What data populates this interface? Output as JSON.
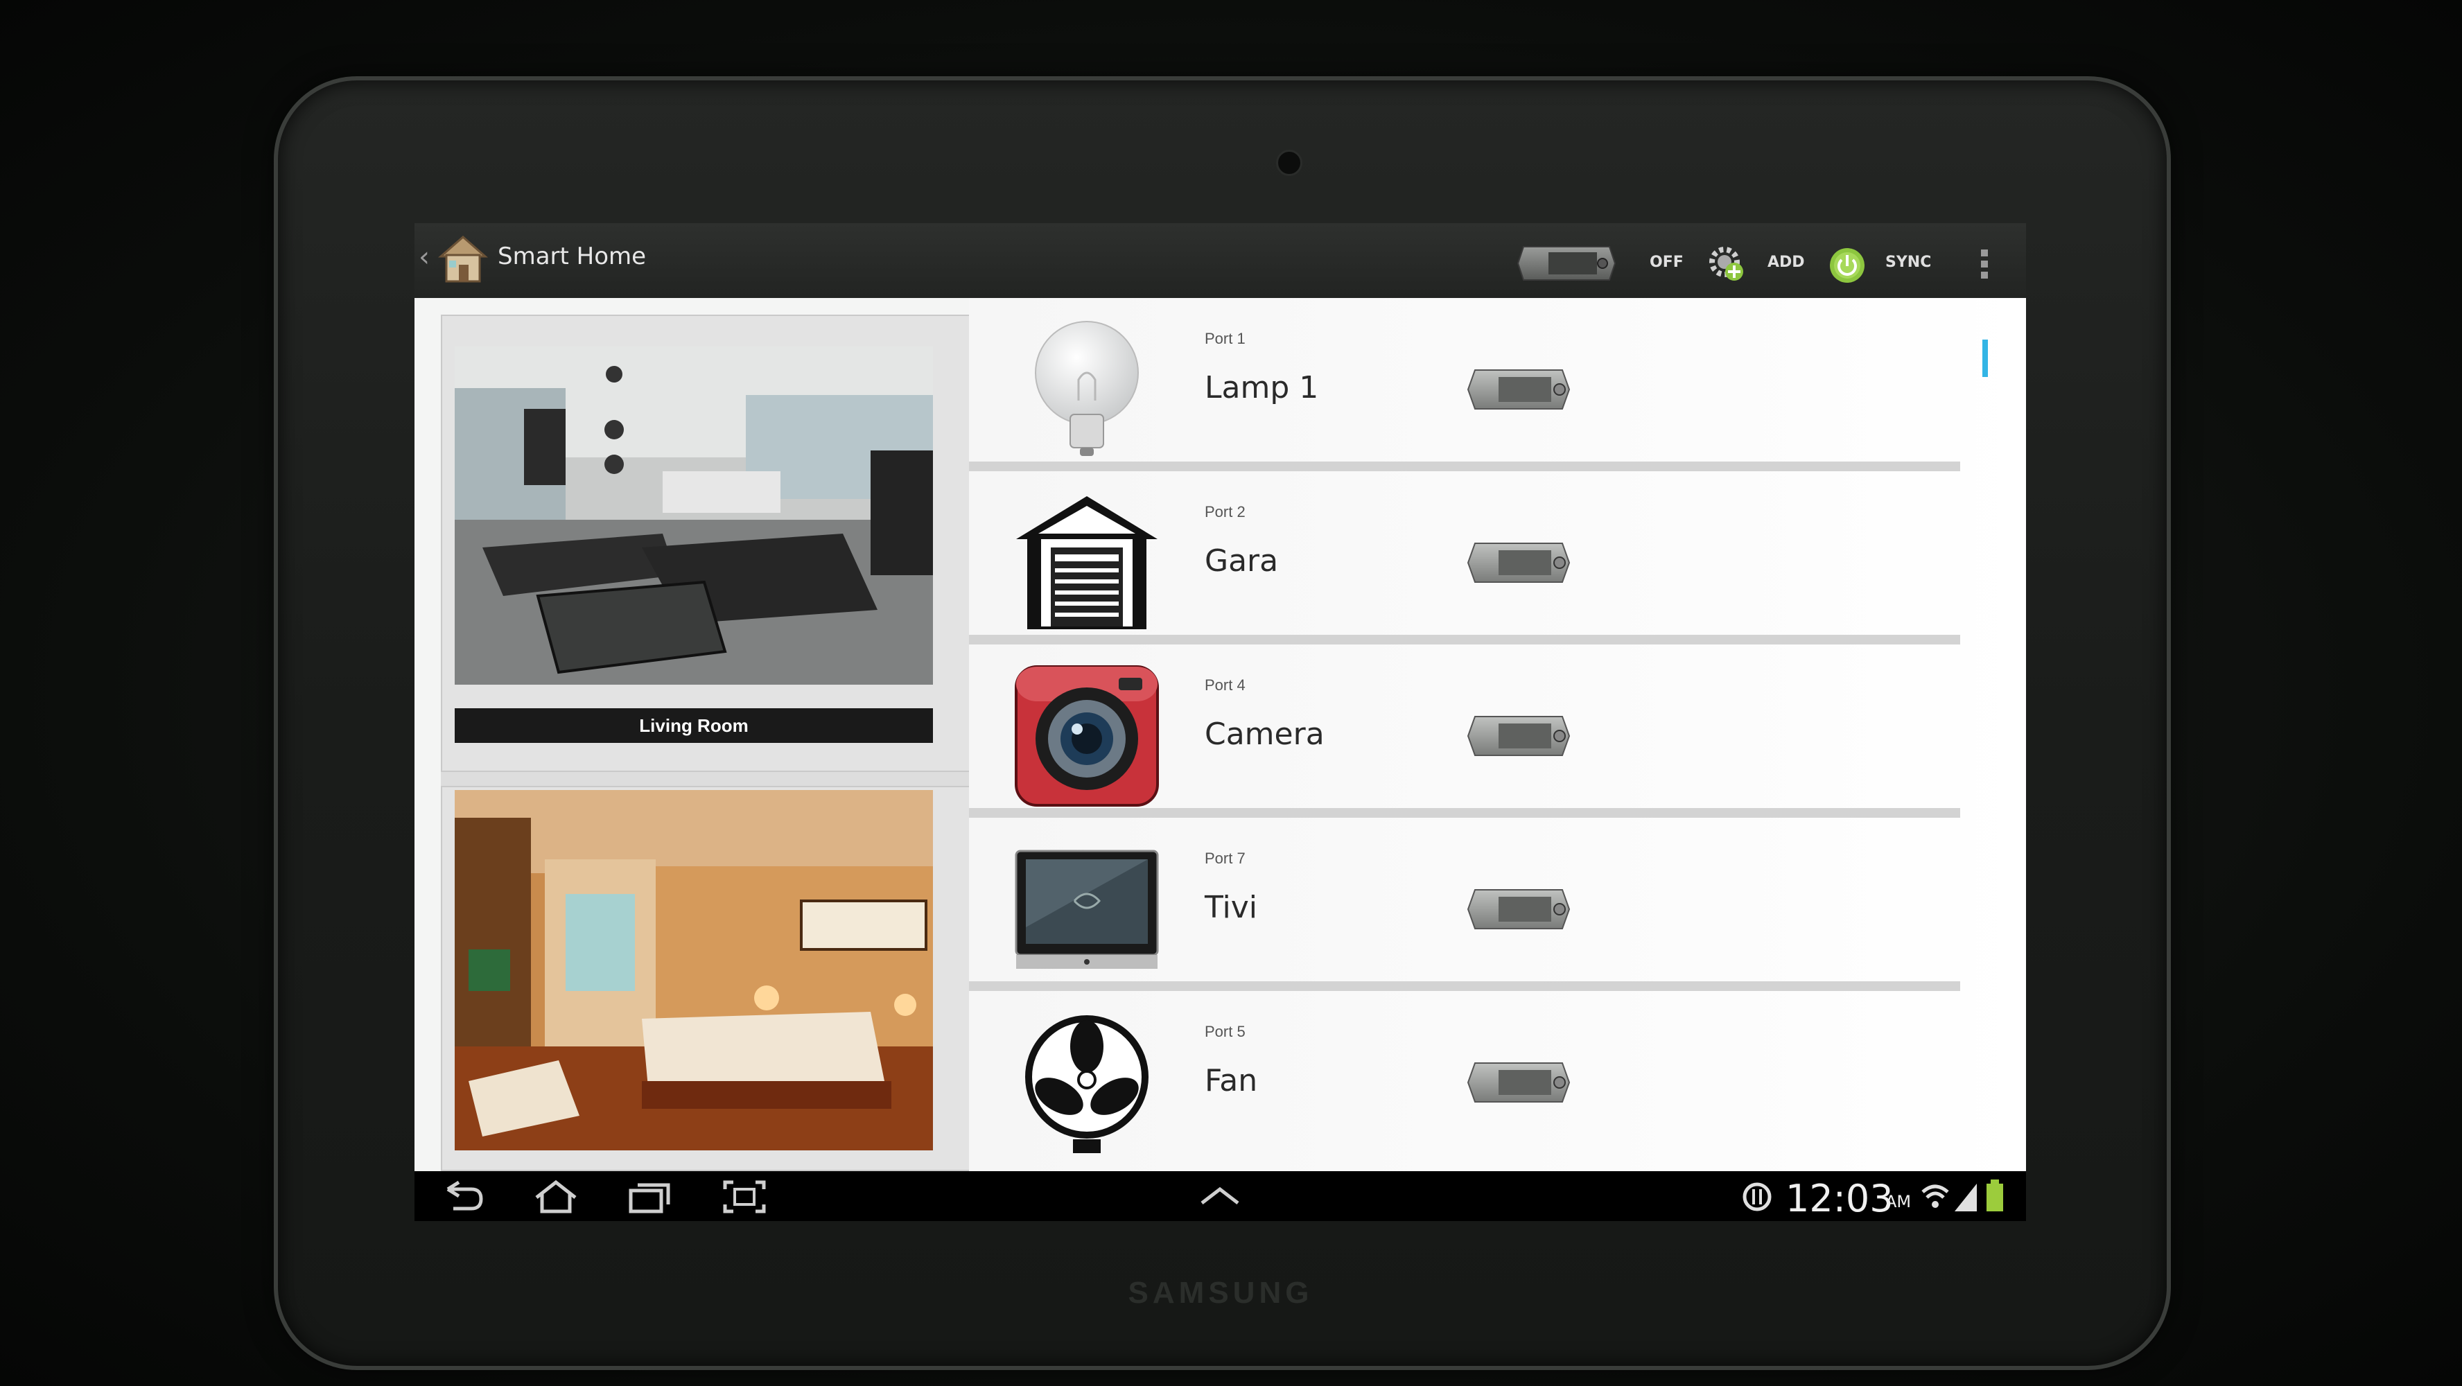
{
  "device": {
    "brand": "SAMSUNG"
  },
  "app": {
    "title": "Smart Home",
    "icons": {
      "back": "chevron-left-icon",
      "app": "house-icon"
    }
  },
  "actions": {
    "master_toggle_state": "off",
    "off_label": "OFF",
    "add_label": "ADD",
    "sync_label": "SYNC",
    "icons": {
      "add": "gear-add-icon",
      "sync": "power-sync-icon",
      "overflow": "overflow-menu-icon"
    }
  },
  "rooms": [
    {
      "label": "Living Room",
      "photo": "living-room-photo"
    },
    {
      "label": "",
      "photo": "bedroom-photo"
    }
  ],
  "devices": [
    {
      "port": "Port 1",
      "name": "Lamp 1",
      "icon": "lamp-icon",
      "state": "off"
    },
    {
      "port": "Port 2",
      "name": "Gara",
      "icon": "garage-icon",
      "state": "off"
    },
    {
      "port": "Port 4",
      "name": "Camera",
      "icon": "camera-icon",
      "state": "off"
    },
    {
      "port": "Port 7",
      "name": "Tivi",
      "icon": "tv-icon",
      "state": "off"
    },
    {
      "port": "Port 5",
      "name": "Fan",
      "icon": "fan-icon",
      "state": "off"
    }
  ],
  "statusbar": {
    "time": "12:03",
    "ampm": "AM",
    "icons": [
      "back-nav-icon",
      "home-nav-icon",
      "recent-apps-icon",
      "screenshot-icon",
      "up-caret-icon",
      "sync-status-icon",
      "wifi-icon",
      "signal-icon",
      "battery-icon"
    ]
  },
  "colors": {
    "accent": "#33b5e5",
    "sync_green": "#8dc63f",
    "camera_red": "#c8323a"
  }
}
